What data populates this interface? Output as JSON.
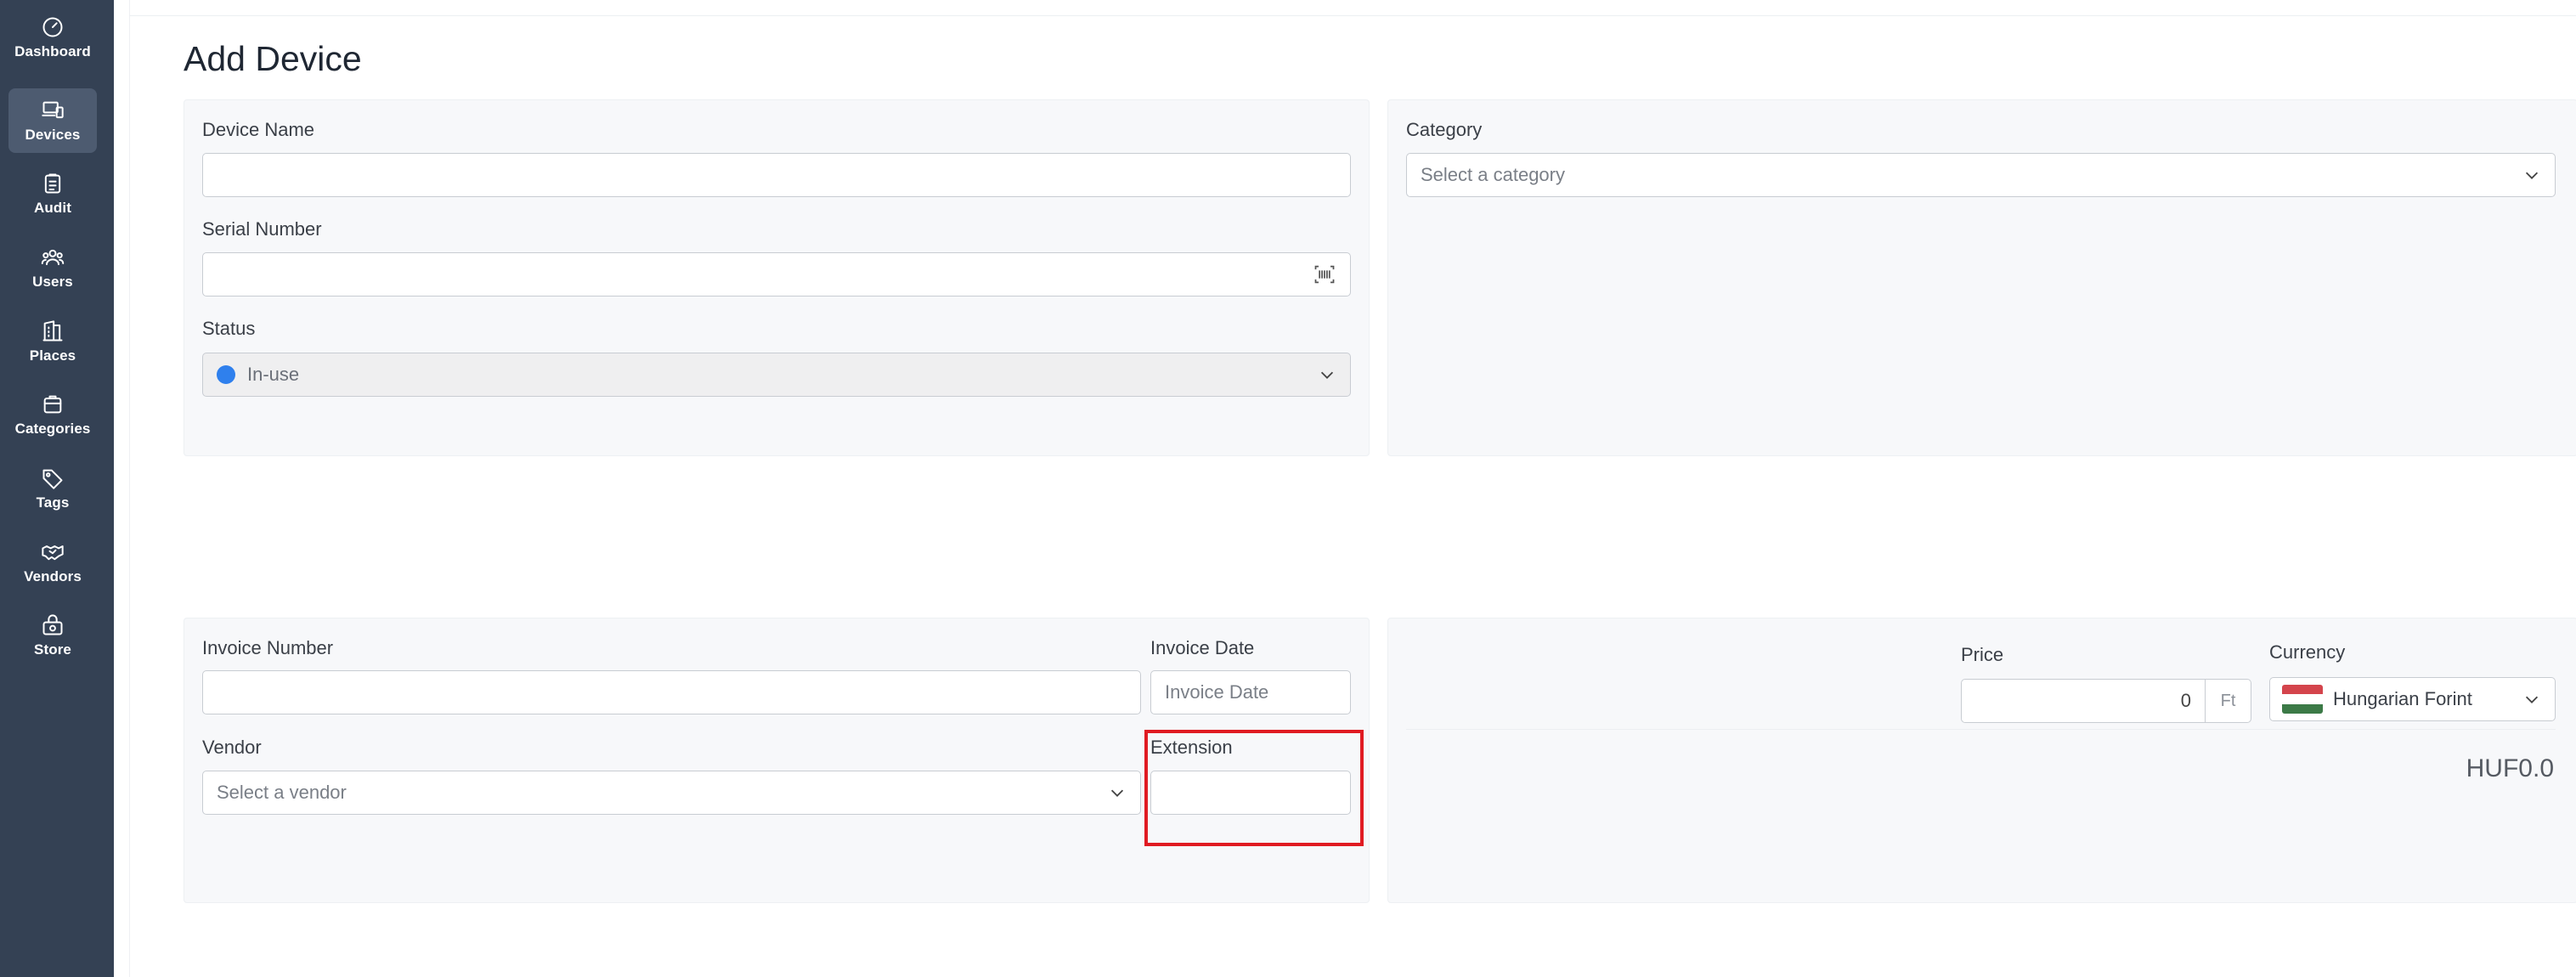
{
  "sidebar": {
    "items": [
      {
        "label": "Dashboard",
        "icon": "dashboard-icon"
      },
      {
        "label": "Devices",
        "icon": "devices-icon",
        "active": true
      },
      {
        "label": "Audit",
        "icon": "audit-icon"
      },
      {
        "label": "Users",
        "icon": "users-icon"
      },
      {
        "label": "Places",
        "icon": "places-icon"
      },
      {
        "label": "Categories",
        "icon": "categories-icon"
      },
      {
        "label": "Tags",
        "icon": "tag-icon"
      },
      {
        "label": "Vendors",
        "icon": "handshake-icon"
      },
      {
        "label": "Store",
        "icon": "store-icon"
      }
    ]
  },
  "page": {
    "title": "Add Device"
  },
  "device_form": {
    "device_name_label": "Device Name",
    "device_name_value": "",
    "serial_number_label": "Serial Number",
    "serial_number_value": "",
    "status_label": "Status",
    "status_value": "In-use",
    "status_color": "#2f80ed",
    "category_label": "Category",
    "category_placeholder": "Select a category"
  },
  "invoice_form": {
    "invoice_number_label": "Invoice Number",
    "invoice_number_value": "",
    "invoice_date_label": "Invoice Date",
    "invoice_date_placeholder": "Invoice Date",
    "vendor_label": "Vendor",
    "vendor_placeholder": "Select a vendor",
    "extension_label": "Extension",
    "extension_value": ""
  },
  "price_form": {
    "price_label": "Price",
    "price_value": "0",
    "price_suffix": "Ft",
    "currency_label": "Currency",
    "currency_value": "Hungarian Forint",
    "currency_flag_colors": [
      "#d4444c",
      "#ffffff",
      "#3c7a47"
    ],
    "total": "HUF0.0"
  },
  "colors": {
    "sidebar_bg": "#344154",
    "highlight": "#e01b22"
  }
}
